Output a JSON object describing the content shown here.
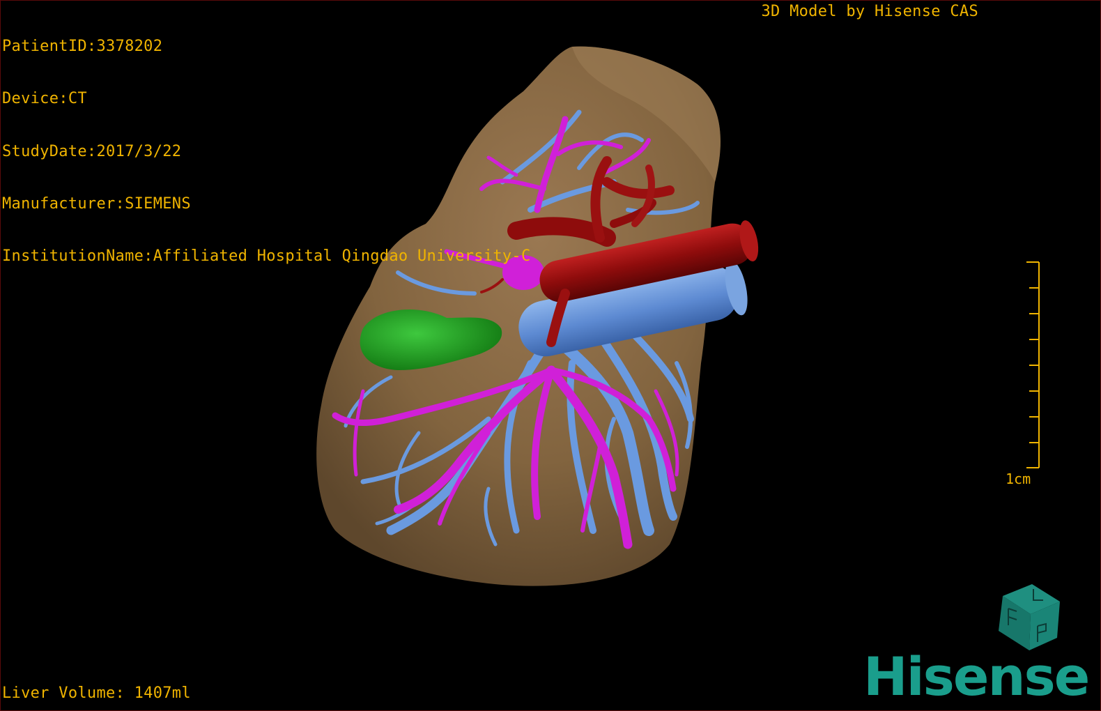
{
  "patient_info": {
    "patient_id": "PatientID:3378202",
    "device": "Device:CT",
    "study_date": "StudyDate:2017/3/22",
    "manufacturer": "Manufacturer:SIEMENS",
    "institution": "InstitutionName:Affiliated Hospital Qingdao University-C"
  },
  "model_credit": "3D Model by Hisense CAS",
  "liver_volume": "Liver Volume: 1407ml",
  "scale": {
    "label": "1cm"
  },
  "brand": {
    "logo_text": "Hisense",
    "color": "#1a9e8c"
  },
  "structures": {
    "liver": {
      "color": "#8a6a48"
    },
    "hepatic_veins": {
      "color": "#6a9ae0"
    },
    "portal_vein": {
      "color": "#d020d8"
    },
    "arteries": {
      "color": "#9a1010"
    },
    "gallbladder": {
      "color": "#1faa1f"
    }
  },
  "overlay_color": "#f0b400"
}
